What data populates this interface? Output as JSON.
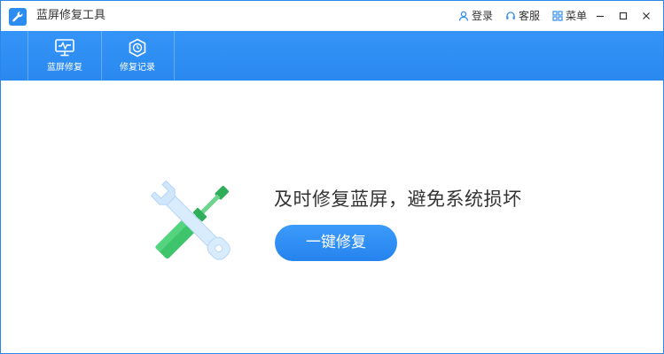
{
  "window": {
    "title": "蓝屏修复工具",
    "header_links": [
      {
        "label": "登录",
        "icon": "user-icon"
      },
      {
        "label": "客服",
        "icon": "headset-icon"
      },
      {
        "label": "菜单",
        "icon": "grid-menu-icon"
      }
    ],
    "controls": [
      "minimize-icon",
      "maximize-icon",
      "close-icon"
    ]
  },
  "toolbar": {
    "items": [
      {
        "label": "蓝屏修复",
        "icon": "monitor-icon"
      },
      {
        "label": "修复记录",
        "icon": "clock-shield-icon"
      }
    ]
  },
  "main": {
    "headline": "及时修复蓝屏，避免系统损坏",
    "button_label": "一键修复",
    "illustration": "wrench-screwdriver-icon"
  },
  "colors": {
    "accent": "#2f8ef4",
    "button": "#2d8cf0",
    "wrench": "#cfe6fb",
    "screwdriver": "#3ec56b"
  }
}
